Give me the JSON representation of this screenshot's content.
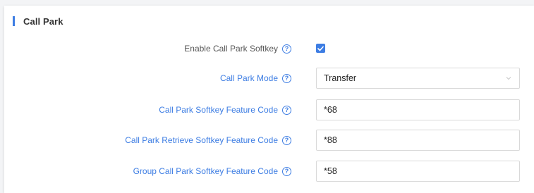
{
  "section": {
    "title": "Call Park"
  },
  "fields": [
    {
      "label": "Enable Call Park Softkey",
      "type": "checkbox",
      "checked": true
    },
    {
      "label": "Call Park Mode",
      "type": "select",
      "value": "Transfer"
    },
    {
      "label": "Call Park Softkey Feature Code",
      "type": "text",
      "value": "*68"
    },
    {
      "label": "Call Park Retrieve Softkey Feature Code",
      "type": "text",
      "value": "*88"
    },
    {
      "label": "Group Call Park Softkey Feature Code",
      "type": "text",
      "value": "*58"
    }
  ],
  "help_glyph": "?",
  "colors": {
    "accent": "#3d7de3",
    "border": "#d9d9d9",
    "label": "#555555"
  },
  "icons": {
    "help": "help-circle-icon",
    "select": "chevron-down-icon",
    "check": "checkmark-icon"
  }
}
